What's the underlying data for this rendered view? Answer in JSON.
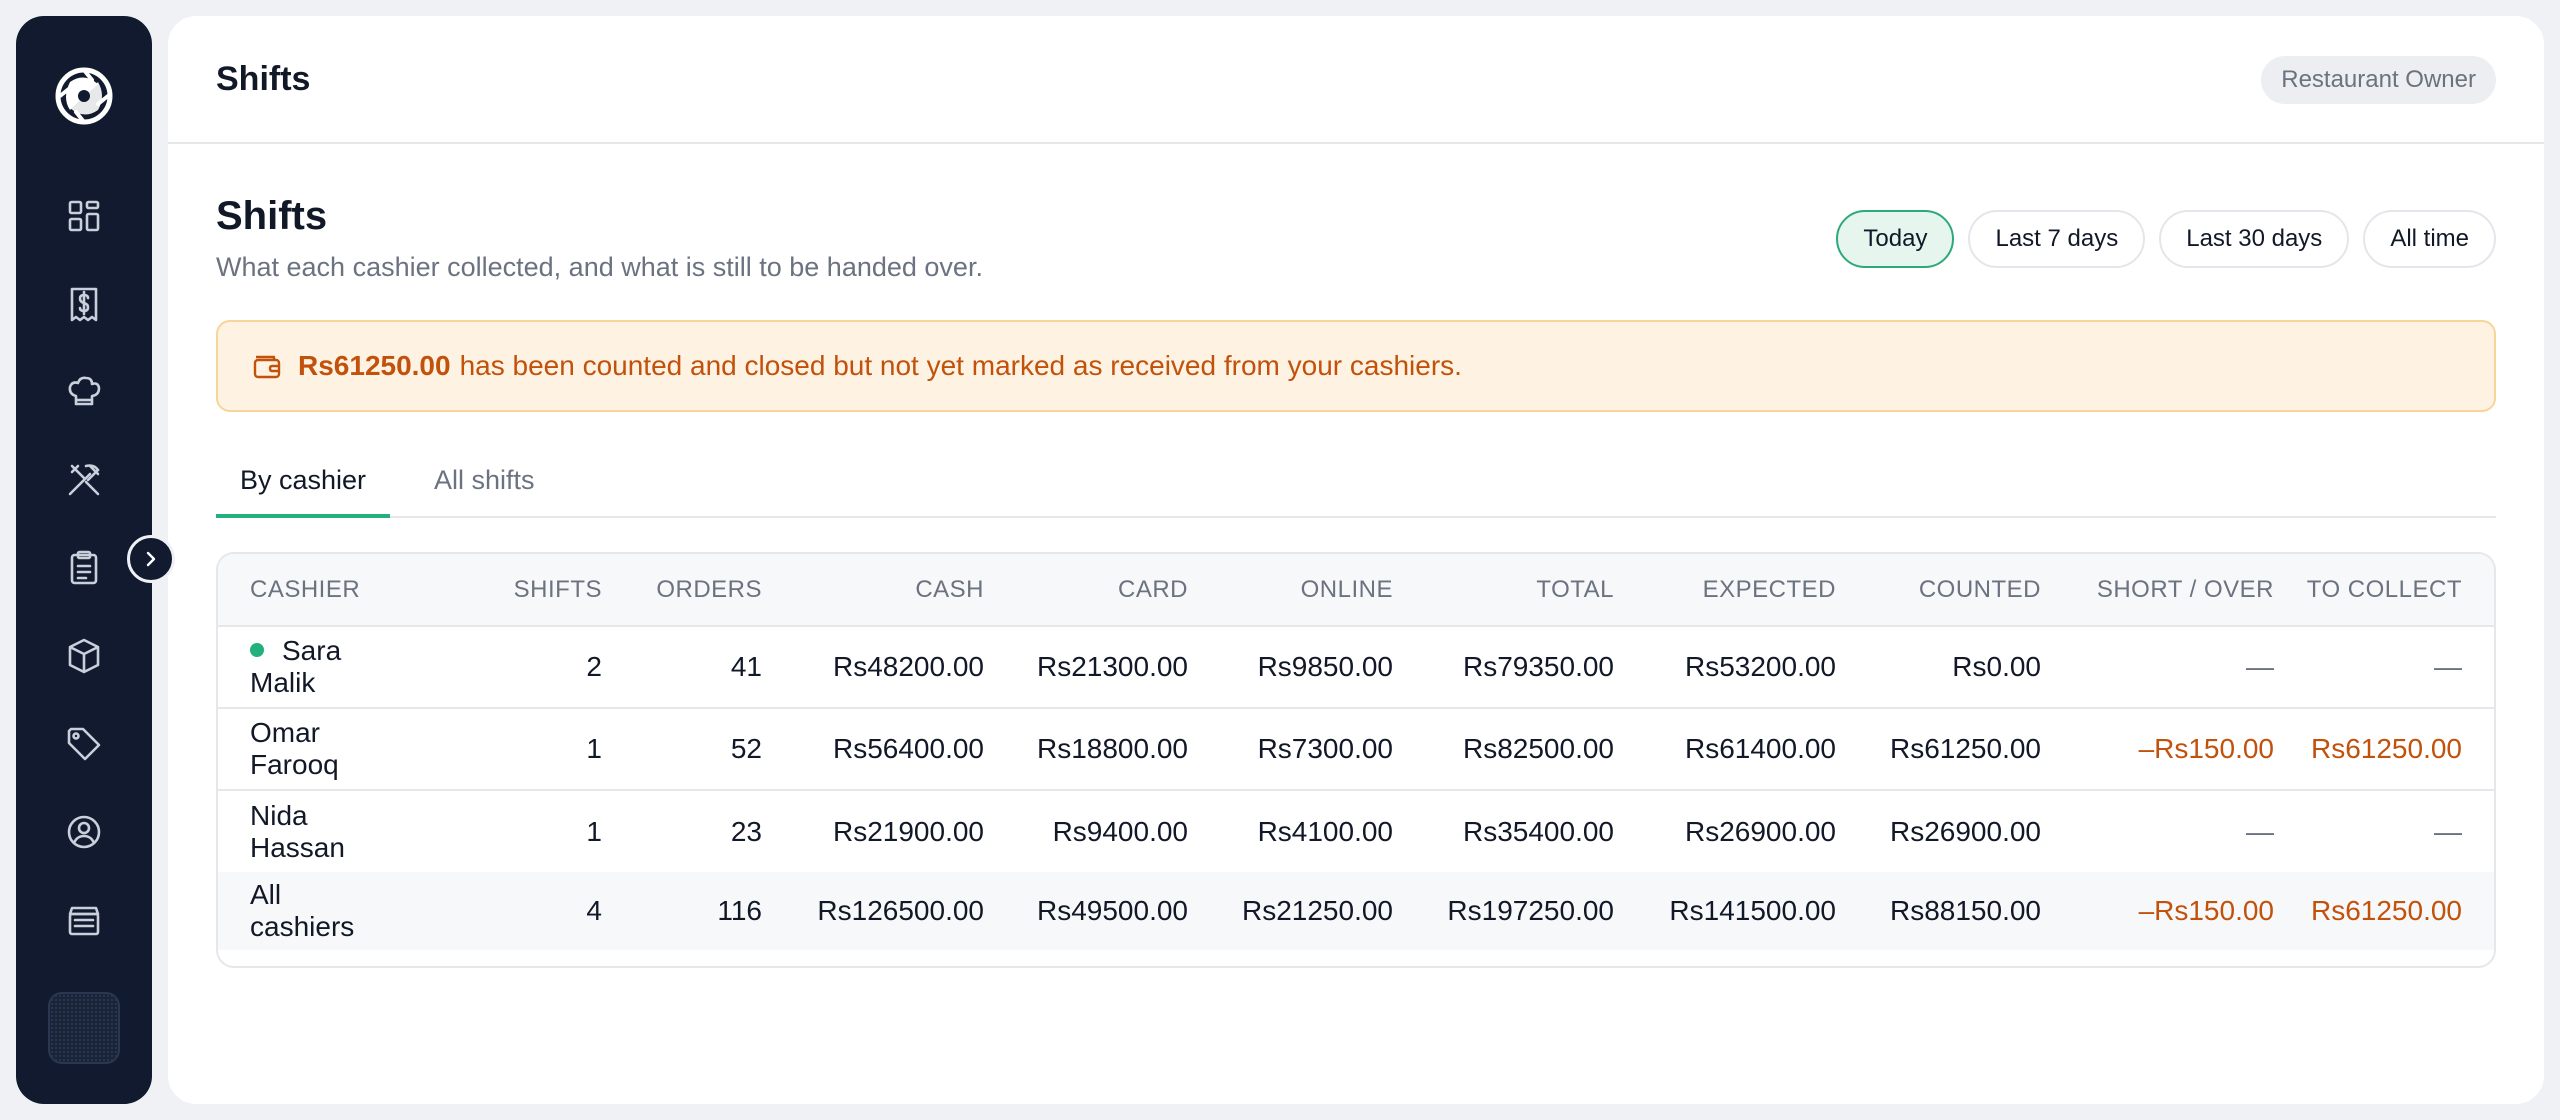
{
  "header": {
    "title": "Shifts",
    "role_badge": "Restaurant Owner"
  },
  "page": {
    "title": "Shifts",
    "subtitle": "What each cashier collected, and what is still to be handed over."
  },
  "filters": [
    {
      "label": "Today",
      "active": true
    },
    {
      "label": "Last 7 days",
      "active": false
    },
    {
      "label": "Last 30 days",
      "active": false
    },
    {
      "label": "All time",
      "active": false
    }
  ],
  "alert": {
    "amount": "Rs61250.00",
    "message": "has been counted and closed but not yet marked as received from your cashiers."
  },
  "tabs": [
    {
      "label": "By cashier",
      "active": true
    },
    {
      "label": "All shifts",
      "active": false
    }
  ],
  "table": {
    "headers": [
      "CASHIER",
      "SHIFTS",
      "ORDERS",
      "CASH",
      "CARD",
      "ONLINE",
      "TOTAL",
      "EXPECTED",
      "COUNTED",
      "SHORT / OVER",
      "TO COLLECT"
    ],
    "rows": [
      {
        "cashier": "Sara Malik",
        "online_now": true,
        "shifts": "2",
        "orders": "41",
        "cash": "Rs48200.00",
        "card": "Rs21300.00",
        "online": "Rs9850.00",
        "total": "Rs79350.00",
        "expected": "Rs53200.00",
        "counted": "Rs0.00",
        "short_over": "—",
        "to_collect": "—"
      },
      {
        "cashier": "Omar Farooq",
        "online_now": false,
        "shifts": "1",
        "orders": "52",
        "cash": "Rs56400.00",
        "card": "Rs18800.00",
        "online": "Rs7300.00",
        "total": "Rs82500.00",
        "expected": "Rs61400.00",
        "counted": "Rs61250.00",
        "short_over": "–Rs150.00",
        "to_collect": "Rs61250.00"
      },
      {
        "cashier": "Nida Hassan",
        "online_now": false,
        "shifts": "1",
        "orders": "23",
        "cash": "Rs21900.00",
        "card": "Rs9400.00",
        "online": "Rs4100.00",
        "total": "Rs35400.00",
        "expected": "Rs26900.00",
        "counted": "Rs26900.00",
        "short_over": "—",
        "to_collect": "—"
      }
    ],
    "totals": {
      "cashier": "All cashiers",
      "shifts": "4",
      "orders": "116",
      "cash": "Rs126500.00",
      "card": "Rs49500.00",
      "online": "Rs21250.00",
      "total": "Rs197250.00",
      "expected": "Rs141500.00",
      "counted": "Rs88150.00",
      "short_over": "–Rs150.00",
      "to_collect": "Rs61250.00"
    }
  },
  "sidebar": {
    "icons": [
      "dashboard-icon",
      "receipt-icon",
      "chef-hat-icon",
      "utensils-icon",
      "clipboard-icon",
      "box-icon",
      "tag-icon",
      "user-circle-icon",
      "register-icon"
    ]
  },
  "colors": {
    "accent_green": "#22b07d",
    "warning_orange": "#c2510c",
    "sidebar_bg": "#111a2e"
  }
}
